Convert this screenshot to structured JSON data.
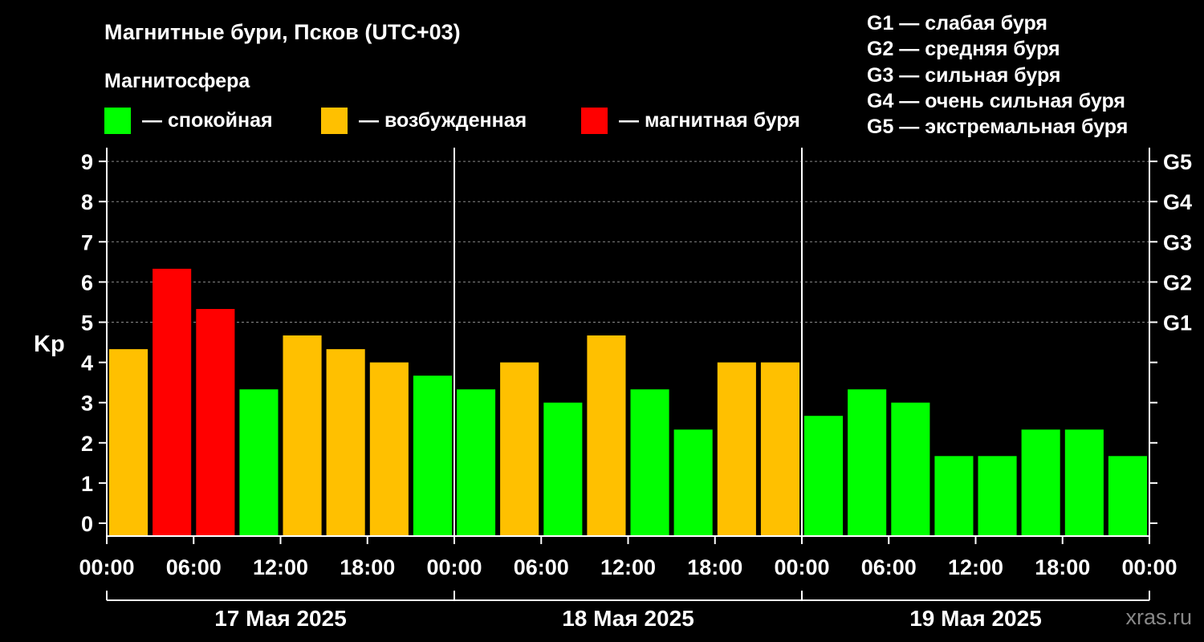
{
  "title": "Магнитные бури, Псков (UTC+03)",
  "magnetosphere_label": "Магнитосфера",
  "colors": {
    "quiet": "#00ff00",
    "excited": "#ffc000",
    "storm": "#ff0000",
    "background": "#000000",
    "foreground": "#ffffff",
    "watermark": "#888888"
  },
  "legend_states": [
    {
      "key": "quiet",
      "label": "— спокойная"
    },
    {
      "key": "excited",
      "label": "— возбужденная"
    },
    {
      "key": "storm",
      "label": "— магнитная буря"
    }
  ],
  "storm_levels_legend": [
    "G1 — слабая буря",
    "G2 — средняя буря",
    "G3 — сильная буря",
    "G4 — очень сильная буря",
    "G5 — экстремальная буря"
  ],
  "watermark": "xras.ru",
  "chart_data": {
    "type": "bar",
    "title": "Магнитные бури, Псков (UTC+03)",
    "ylabel": "Kp",
    "ylim": [
      0,
      9
    ],
    "y_ticks": [
      "0",
      "1",
      "2",
      "3",
      "4",
      "5",
      "6",
      "7",
      "8",
      "9"
    ],
    "grid": "dashed horizontal at Kp 5–9",
    "right_axis": [
      {
        "kp": 5,
        "label": "G1"
      },
      {
        "kp": 6,
        "label": "G2"
      },
      {
        "kp": 7,
        "label": "G3"
      },
      {
        "kp": 8,
        "label": "G4"
      },
      {
        "kp": 9,
        "label": "G5"
      }
    ],
    "x_tick_labels": [
      "00:00",
      "06:00",
      "12:00",
      "18:00",
      "00:00",
      "06:00",
      "12:00",
      "18:00",
      "00:00",
      "06:00",
      "12:00",
      "18:00",
      "00:00"
    ],
    "days": [
      "17 Мая 2025",
      "18 Мая 2025",
      "19 Мая 2025"
    ],
    "interval_hours": 3,
    "values": [
      4.33,
      6.33,
      5.33,
      3.33,
      4.67,
      4.33,
      4.0,
      3.67,
      3.33,
      4.0,
      3.0,
      4.67,
      3.33,
      2.33,
      4.0,
      4.0,
      2.67,
      3.33,
      3.0,
      1.67,
      1.67,
      2.33,
      2.33,
      1.67
    ],
    "states": [
      "excited",
      "storm",
      "storm",
      "quiet",
      "excited",
      "excited",
      "excited",
      "quiet",
      "quiet",
      "excited",
      "quiet",
      "excited",
      "quiet",
      "quiet",
      "excited",
      "excited",
      "quiet",
      "quiet",
      "quiet",
      "quiet",
      "quiet",
      "quiet",
      "quiet",
      "quiet"
    ]
  }
}
